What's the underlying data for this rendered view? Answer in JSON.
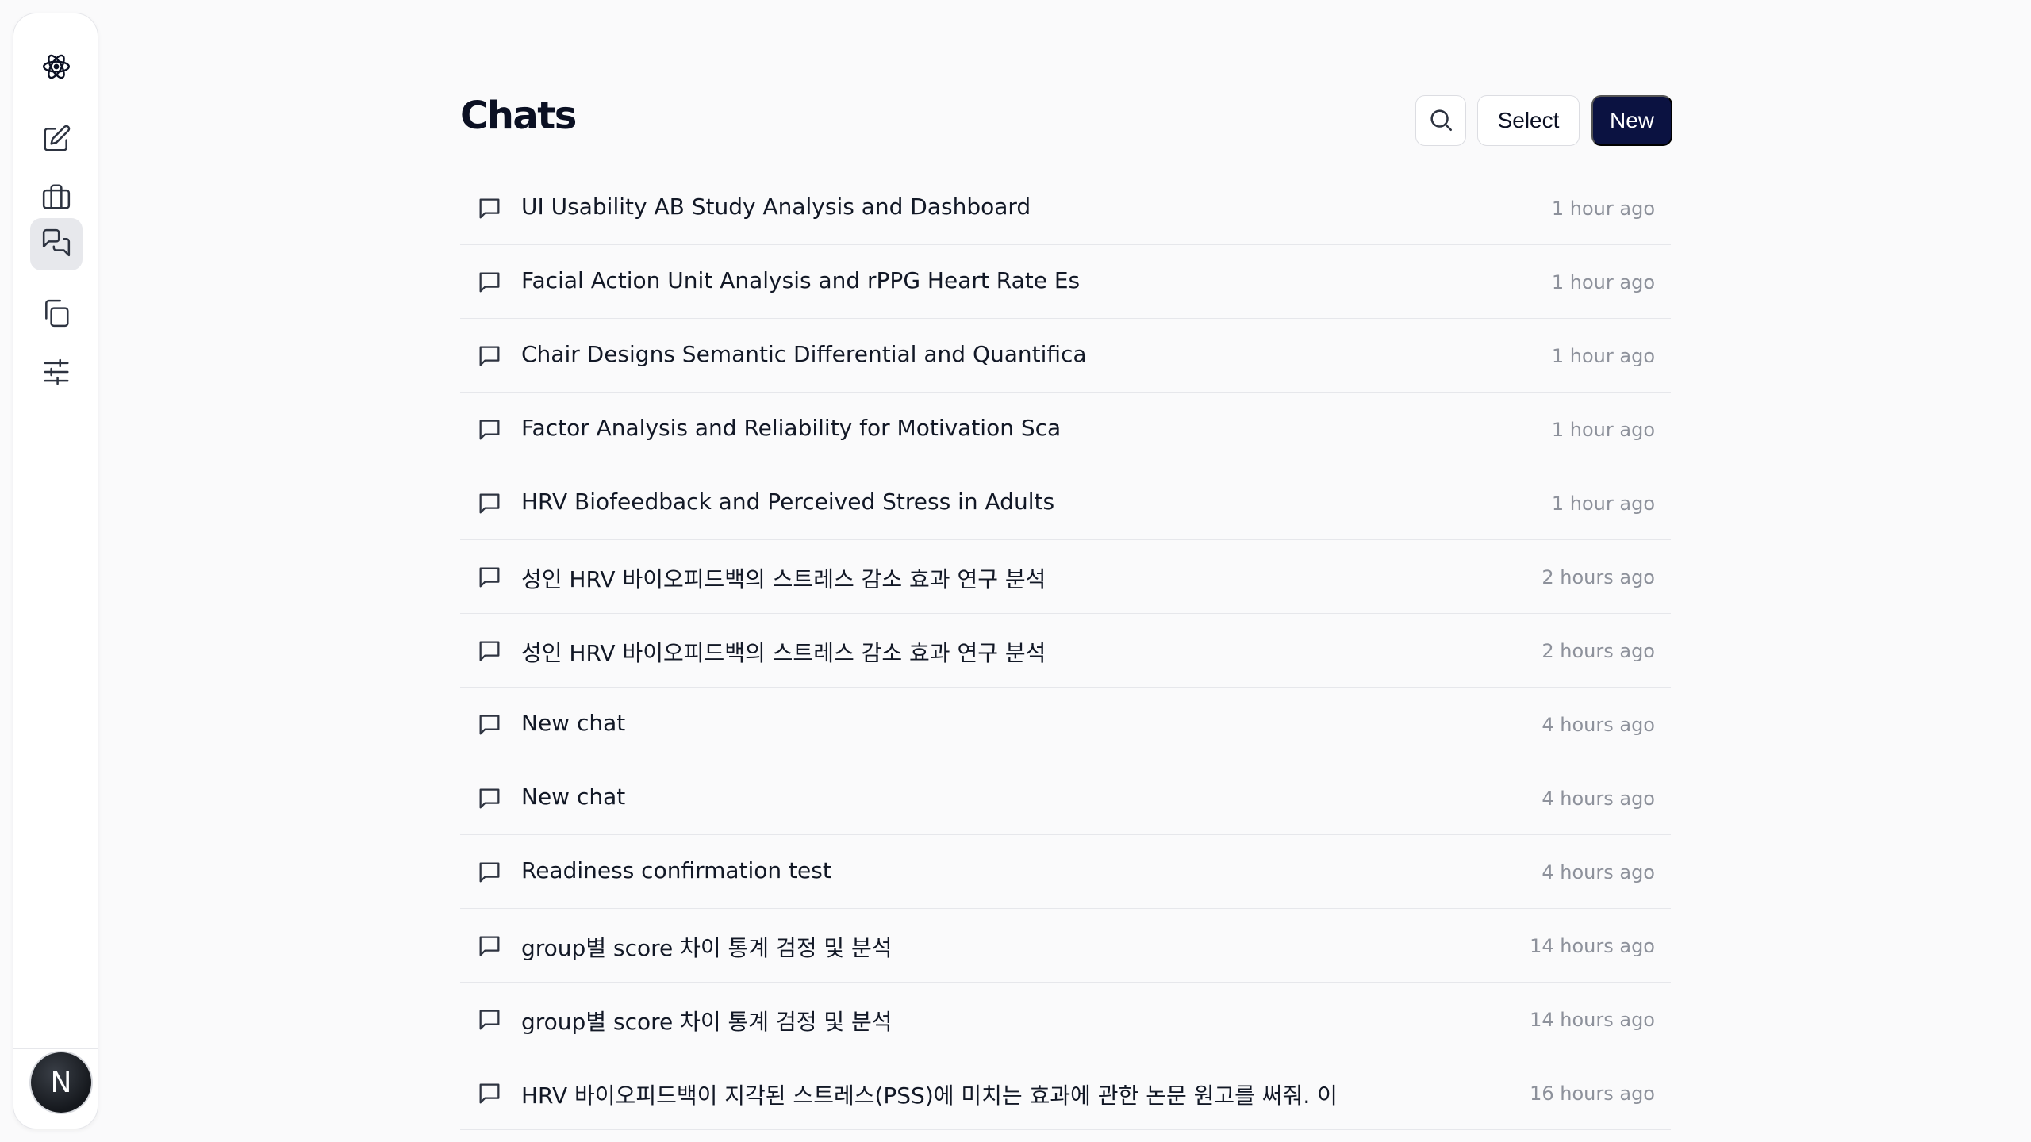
{
  "sidebar": {
    "items": [
      {
        "name": "logo",
        "icon": "atom-icon"
      },
      {
        "name": "new-chat",
        "icon": "edit-icon"
      },
      {
        "name": "projects",
        "icon": "briefcase-icon"
      },
      {
        "name": "chats",
        "icon": "chats-icon",
        "active": true
      },
      {
        "name": "documents",
        "icon": "copy-icon"
      },
      {
        "name": "settings",
        "icon": "sliders-icon"
      }
    ],
    "avatar_letter": "N"
  },
  "header": {
    "title": "Chats",
    "search_icon": "search-icon",
    "select_label": "Select",
    "new_label": "New"
  },
  "chats": [
    {
      "title": "UI Usability AB Study Analysis and Dashboard",
      "time": "1 hour ago"
    },
    {
      "title": "Facial Action Unit Analysis and rPPG Heart Rate Es",
      "time": "1 hour ago"
    },
    {
      "title": "Chair Designs Semantic Differential and Quantifica",
      "time": "1 hour ago"
    },
    {
      "title": "Factor Analysis and Reliability for Motivation Sca",
      "time": "1 hour ago"
    },
    {
      "title": "HRV Biofeedback and Perceived Stress in Adults",
      "time": "1 hour ago"
    },
    {
      "title": "성인 HRV 바이오피드백의 스트레스 감소 효과 연구 분석",
      "time": "2 hours ago"
    },
    {
      "title": "성인 HRV 바이오피드백의 스트레스 감소 효과 연구 분석",
      "time": "2 hours ago"
    },
    {
      "title": "New chat",
      "time": "4 hours ago"
    },
    {
      "title": "New chat",
      "time": "4 hours ago"
    },
    {
      "title": "Readiness confirmation test",
      "time": "4 hours ago"
    },
    {
      "title": "group별 score 차이 통계 검정 및 분석",
      "time": "14 hours ago"
    },
    {
      "title": "group별 score 차이 통계 검정 및 분석",
      "time": "14 hours ago"
    },
    {
      "title": "HRV 바이오피드백이 지각된 스트레스(PSS)에 미치는 효과에 관한 논문 원고를 써줘. 이",
      "time": "16 hours ago"
    }
  ],
  "colors": {
    "background": "#fafafb",
    "primary_button": "#0b1241",
    "active_nav": "#e7e8ec",
    "muted_text": "#8d919b"
  }
}
